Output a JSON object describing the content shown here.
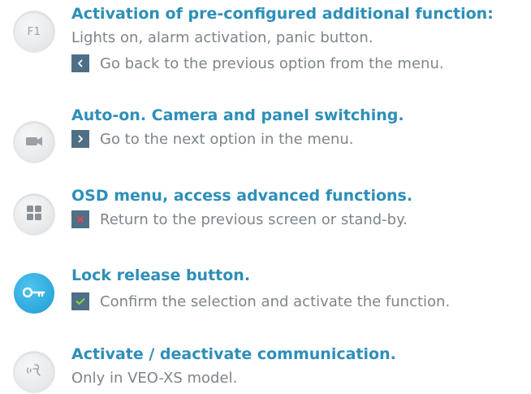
{
  "items": [
    {
      "button_label": "F1",
      "button_icon": "f1-icon",
      "heading": "Activation of pre-configured additional function:",
      "description": "Lights on, alarm activation, panic button.",
      "nav_icon": "chevron-left-icon",
      "nav_text": "Go back to the previous option from the menu."
    },
    {
      "button_icon": "camera-icon",
      "heading": "Auto-on. Camera and panel switching.",
      "nav_icon": "chevron-right-icon",
      "nav_text": "Go to the next option in the menu."
    },
    {
      "button_icon": "menu-grid-icon",
      "heading": "OSD menu, access advanced functions.",
      "nav_icon": "close-icon",
      "nav_text": "Return to the previous screen or stand-by."
    },
    {
      "button_icon": "key-icon",
      "heading": "Lock release button.",
      "nav_icon": "check-icon",
      "nav_text": "Confirm the selection and activate the function."
    },
    {
      "button_icon": "communication-icon",
      "heading": "Activate / deactivate communication.",
      "description": "Only in VEO-XS model."
    }
  ],
  "colors": {
    "heading": "#2d8fb8",
    "text": "#7d858c",
    "nav_icon_bg": "#4f6f86",
    "close_x": "#e8414f",
    "check": "#8cd63c",
    "lock_button": "#2ea8dc"
  }
}
